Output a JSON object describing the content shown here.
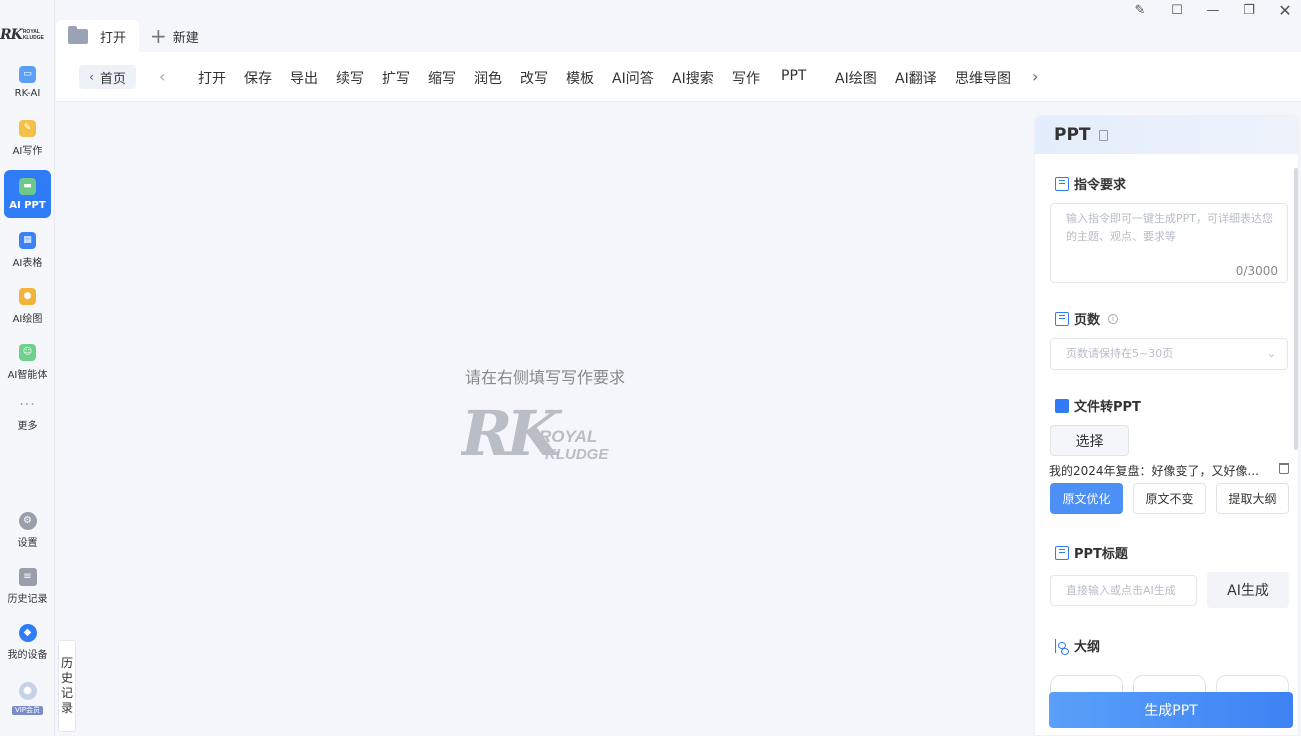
{
  "sidebar": {
    "logo_text": "RK",
    "logo_sub": "ROYAL KLUDGE",
    "items": [
      {
        "label": "RK-AI",
        "icon": "monitor-icon",
        "color": "#5aa0f5"
      },
      {
        "label": "AI写作",
        "icon": "pencil-icon",
        "color": "#f3c14b"
      },
      {
        "label": "AI PPT",
        "icon": "presentation-icon",
        "color": "#6ec88a"
      },
      {
        "label": "AI表格",
        "icon": "sheet-icon",
        "color": "#3d82f4"
      },
      {
        "label": "AI绘图",
        "icon": "palette-icon",
        "color": "#f3b43a"
      },
      {
        "label": "AI智能体",
        "icon": "robot-icon",
        "color": "#6ed18d"
      },
      {
        "label": "更多",
        "icon": "more-icon",
        "color": "#999999"
      }
    ],
    "bottom": [
      {
        "label": "设置",
        "icon": "gear-icon"
      },
      {
        "label": "历史记录",
        "icon": "history-icon"
      },
      {
        "label": "我的设备",
        "icon": "device-icon"
      }
    ],
    "vip": "VIP会员"
  },
  "tabs": {
    "open_label": "打开",
    "new_label": "新建"
  },
  "toolbar": {
    "home_label": "首页",
    "items": [
      "打开",
      "保存",
      "导出",
      "续写",
      "扩写",
      "缩写",
      "润色",
      "改写",
      "模板",
      "AI问答",
      "AI搜索",
      "写作",
      "PPT",
      "AI绘图",
      "AI翻译",
      "思维导图"
    ]
  },
  "canvas": {
    "hint": "请在右侧填写写作要求",
    "history_tab": [
      "历",
      "史",
      "记",
      "录"
    ]
  },
  "panel": {
    "title": "PPT",
    "instruction": {
      "title": "指令要求",
      "placeholder": "输入指令即可一键生成PPT，可详细表达您的主题、观点、要求等",
      "count": "0/3000"
    },
    "pages": {
      "title": "页数",
      "placeholder": "页数请保持在5~30页"
    },
    "file_to_ppt": {
      "title": "文件转PPT",
      "choose_label": "选择",
      "file_name": "我的2024年复盘：好像变了，又好像...",
      "options": [
        "原文优化",
        "原文不变",
        "提取大纲"
      ]
    },
    "ppt_title": {
      "title": "PPT标题",
      "placeholder": "直接输入或点击AI生成",
      "ai_label": "AI生成"
    },
    "outline": {
      "title": "大纲"
    },
    "generate_label": "生成PPT"
  },
  "colors": {
    "accent": "#2f7cf6",
    "background": "#f4f6fb"
  }
}
